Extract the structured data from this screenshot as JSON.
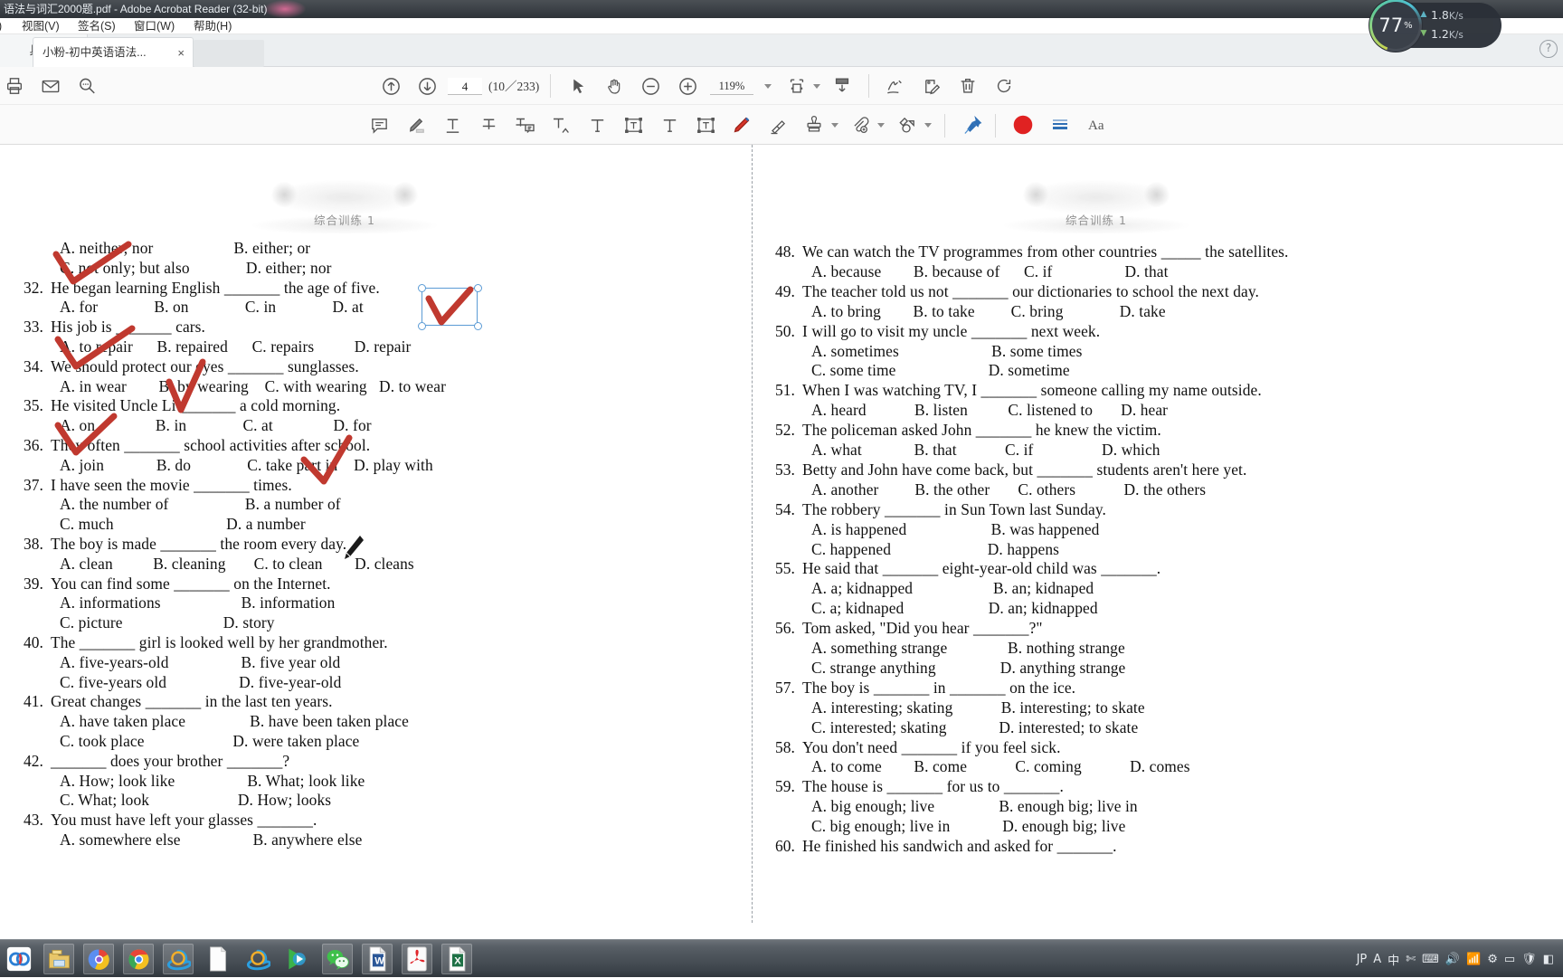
{
  "window": {
    "title": "语法与词汇2000题.pdf - Adobe Acrobat Reader (32-bit)",
    "menus": [
      {
        "label": "视图(V)"
      },
      {
        "label": "签名(S)"
      },
      {
        "label": "窗口(W)"
      },
      {
        "label": "帮助(H)"
      }
    ],
    "tools_tab_label": "具",
    "document_tab_label": "小粉-初中英语语法...",
    "document_tab_close": "×"
  },
  "toolbar": {
    "print_icon": "printer-icon",
    "email_icon": "envelope-icon",
    "search_icon": "magnifier-icon",
    "prev_page_icon": "arrow-up-circle-icon",
    "next_page_icon": "arrow-down-circle-icon",
    "page_number_value": "4",
    "page_count_label": "(10／233)",
    "select_icon": "cursor-arrow-icon",
    "hand_icon": "hand-icon",
    "zoom_out_icon": "minus-circle-icon",
    "zoom_in_icon": "plus-circle-icon",
    "zoom_value": "119%",
    "zoom_dropdown_icon": "chevron-down-icon",
    "fit_page_icon": "fit-page-icon",
    "fit_dropdown_icon": "chevron-down-icon",
    "scroll_mode_icon": "scroll-mode-icon",
    "sign_icon": "sign-pen-icon",
    "fill_sign_icon": "fill-and-sign-icon",
    "delete_icon": "trash-icon",
    "rotate_icon": "rotate-icon"
  },
  "annotation_toolbar": {
    "sticky_note_icon": "comment-balloon-icon",
    "highlight_icon": "highlighter-icon",
    "underline_icon": "text-underline-icon",
    "strikethrough_icon": "text-strikethrough-icon",
    "replace_text_icon": "text-replace-note-icon",
    "insert_text_icon": "text-insert-caret-icon",
    "add_text_icon": "add-text-icon",
    "text_box_icon": "text-box-icon",
    "draw_icon": "pencil-draw-icon",
    "eraser_icon": "eraser-icon",
    "stamp_icon": "stamp-icon",
    "stamp_dropdown_icon": "chevron-down-icon",
    "attach_icon": "attach-file-icon",
    "attach_dropdown_icon": "chevron-down-icon",
    "shape_icon": "shape-tool-icon",
    "shape_dropdown_icon": "chevron-down-icon",
    "pin_icon": "pin-icon",
    "color_swatch_icon": "red-color-circle-icon",
    "line_thickness_icon": "line-thickness-icon",
    "font_icon": "font-Aa-icon"
  },
  "network_widget": {
    "cpu_percent": "77",
    "percent_symbol": "%",
    "upload_speed": "1.8",
    "upload_unit": "K/s",
    "download_speed": "1.2",
    "download_unit": "K/s",
    "up_arrow_icon": "arrow-up-icon",
    "down_arrow_icon": "arrow-down-icon"
  },
  "help_button": {
    "label": "?"
  },
  "document": {
    "left_page": {
      "header_caption": "综合训练 1",
      "lines": [
        {
          "indent": 44,
          "num": "",
          "text": "A. neither; nor                    B. either; or"
        },
        {
          "indent": 44,
          "num": "",
          "text": "C. not only; but also              D. either; nor"
        },
        {
          "indent": 0,
          "num": "32.",
          "text": "He began learning English _______ the age of five."
        },
        {
          "indent": 44,
          "num": "",
          "text": "A. for              B. on              C. in              D. at"
        },
        {
          "indent": 0,
          "num": "33.",
          "text": "His job is _______ cars."
        },
        {
          "indent": 44,
          "num": "",
          "text": "A. to repair      B. repaired      C. repairs          D. repair"
        },
        {
          "indent": 0,
          "num": "34.",
          "text": "We should protect our eyes _______ sunglasses."
        },
        {
          "indent": 44,
          "num": "",
          "text": "A. in wear        B. by wearing    C. with wearing   D. to wear"
        },
        {
          "indent": 0,
          "num": "35.",
          "text": "He visited Uncle Li _______ a cold morning."
        },
        {
          "indent": 44,
          "num": "",
          "text": "A. on               B. in              C. at               D. for"
        },
        {
          "indent": 0,
          "num": "36.",
          "text": "They often _______ school activities after school."
        },
        {
          "indent": 44,
          "num": "",
          "text": "A. join             B. do              C. take part in    D. play with"
        },
        {
          "indent": 0,
          "num": "37.",
          "text": "I have seen the movie _______ times."
        },
        {
          "indent": 44,
          "num": "",
          "text": "A. the number of                   B. a number of"
        },
        {
          "indent": 44,
          "num": "",
          "text": "C. much                            D. a number"
        },
        {
          "indent": 0,
          "num": "38.",
          "text": "The boy is made _______ the room every day."
        },
        {
          "indent": 44,
          "num": "",
          "text": "A. clean          B. cleaning       C. to clean        D. cleans"
        },
        {
          "indent": 0,
          "num": "39.",
          "text": "You can find some _______ on the Internet."
        },
        {
          "indent": 44,
          "num": "",
          "text": "A. informations                    B. information"
        },
        {
          "indent": 44,
          "num": "",
          "text": "C. picture                         D. story"
        },
        {
          "indent": 0,
          "num": "40.",
          "text": "The _______ girl is looked well by her grandmother."
        },
        {
          "indent": 44,
          "num": "",
          "text": "A. five-years-old                  B. five year old"
        },
        {
          "indent": 44,
          "num": "",
          "text": "C. five-years old                  D. five-year-old"
        },
        {
          "indent": 0,
          "num": "41.",
          "text": "Great changes _______ in the last ten years."
        },
        {
          "indent": 44,
          "num": "",
          "text": "A. have taken place                B. have been taken place"
        },
        {
          "indent": 44,
          "num": "",
          "text": "C. took place                      D. were taken place"
        },
        {
          "indent": 0,
          "num": "42.",
          "text": "_______ does your brother _______?"
        },
        {
          "indent": 44,
          "num": "",
          "text": "A. How; look like                  B. What; look like"
        },
        {
          "indent": 44,
          "num": "",
          "text": "C. What; look                      D. How; looks"
        },
        {
          "indent": 0,
          "num": "43.",
          "text": "You must have left your glasses _______."
        },
        {
          "indent": 44,
          "num": "",
          "text": "A. somewhere else                  B. anywhere else"
        }
      ]
    },
    "right_page": {
      "header_caption": "综合训练 1",
      "lines": [
        {
          "indent": 0,
          "num": "48.",
          "text": "We can watch the TV programmes from other countries _____ the satellites."
        },
        {
          "indent": 44,
          "num": "",
          "text": "A. because        B. because of      C. if                  D. that"
        },
        {
          "indent": 0,
          "num": "49.",
          "text": "The teacher told us not _______ our dictionaries to school the next day."
        },
        {
          "indent": 44,
          "num": "",
          "text": "A. to bring        B. to take         C. bring              D. take"
        },
        {
          "indent": 0,
          "num": "50.",
          "text": "I will go to visit my uncle _______ next week."
        },
        {
          "indent": 44,
          "num": "",
          "text": "A. sometimes                       B. some times"
        },
        {
          "indent": 44,
          "num": "",
          "text": "C. some time                       D. sometime"
        },
        {
          "indent": 0,
          "num": "51.",
          "text": "When I was watching TV, I _______ someone calling my name outside."
        },
        {
          "indent": 44,
          "num": "",
          "text": "A. heard            B. listen          C. listened to       D. hear"
        },
        {
          "indent": 0,
          "num": "52.",
          "text": "The policeman asked John _______ he knew the victim."
        },
        {
          "indent": 44,
          "num": "",
          "text": "A. what             B. that            C. if                 D. which"
        },
        {
          "indent": 0,
          "num": "53.",
          "text": "Betty and John have come back, but _______ students aren't here yet."
        },
        {
          "indent": 44,
          "num": "",
          "text": "A. another         B. the other       C. others            D. the others"
        },
        {
          "indent": 0,
          "num": "54.",
          "text": "The robbery _______ in Sun Town last Sunday."
        },
        {
          "indent": 44,
          "num": "",
          "text": "A. is happened                     B. was happened"
        },
        {
          "indent": 44,
          "num": "",
          "text": "C. happened                        D. happens"
        },
        {
          "indent": 0,
          "num": "55.",
          "text": "He said that _______ eight-year-old child was _______."
        },
        {
          "indent": 44,
          "num": "",
          "text": "A. a; kidnapped                    B. an; kidnaped"
        },
        {
          "indent": 44,
          "num": "",
          "text": "C. a; kidnaped                     D. an; kidnapped"
        },
        {
          "indent": 0,
          "num": "56.",
          "text": "Tom asked, \"Did you hear _______?\""
        },
        {
          "indent": 44,
          "num": "",
          "text": "A. something strange               B. nothing strange"
        },
        {
          "indent": 44,
          "num": "",
          "text": "C. strange anything                D. anything strange"
        },
        {
          "indent": 0,
          "num": "57.",
          "text": "The boy is _______ in _______ on the ice."
        },
        {
          "indent": 44,
          "num": "",
          "text": "A. interesting; skating            B. interesting; to skate"
        },
        {
          "indent": 44,
          "num": "",
          "text": "C. interested; skating             D. interested; to skate"
        },
        {
          "indent": 0,
          "num": "58.",
          "text": "You don't need _______ if you feel sick."
        },
        {
          "indent": 44,
          "num": "",
          "text": "A. to come        B. come            C. coming            D. comes"
        },
        {
          "indent": 0,
          "num": "59.",
          "text": "The house is _______ for us to _______."
        },
        {
          "indent": 44,
          "num": "",
          "text": "A. big enough; live                B. enough big; live in"
        },
        {
          "indent": 44,
          "num": "",
          "text": "C. big enough; live in             D. enough big; live"
        },
        {
          "indent": 0,
          "num": "60.",
          "text": "He finished his sandwich and asked for _______."
        }
      ]
    },
    "selected_annotation": {
      "label": "selected-ink-annotation-around-option-D-at",
      "handle_color": "#5b9bd5"
    },
    "ink_color": "#c0392f"
  },
  "taskbar": {
    "items": [
      {
        "name": "360-browser-icon"
      },
      {
        "name": "file-explorer-icon"
      },
      {
        "name": "chrome-canary-icon"
      },
      {
        "name": "chrome-icon"
      },
      {
        "name": "internet-explorer-icon"
      },
      {
        "name": "notepad-document-icon"
      },
      {
        "name": "internet-explorer-window-icon"
      },
      {
        "name": "potplayer-icon"
      },
      {
        "name": "wechat-icon"
      },
      {
        "name": "word-icon"
      },
      {
        "name": "acrobat-reader-icon"
      },
      {
        "name": "excel-icon"
      }
    ],
    "tray": {
      "ime_label": "JP",
      "glyphs": [
        "A",
        "中",
        "✄",
        "⌨",
        "🔊",
        "📶",
        "⚙",
        "▭",
        "🛡",
        "◧"
      ]
    }
  }
}
